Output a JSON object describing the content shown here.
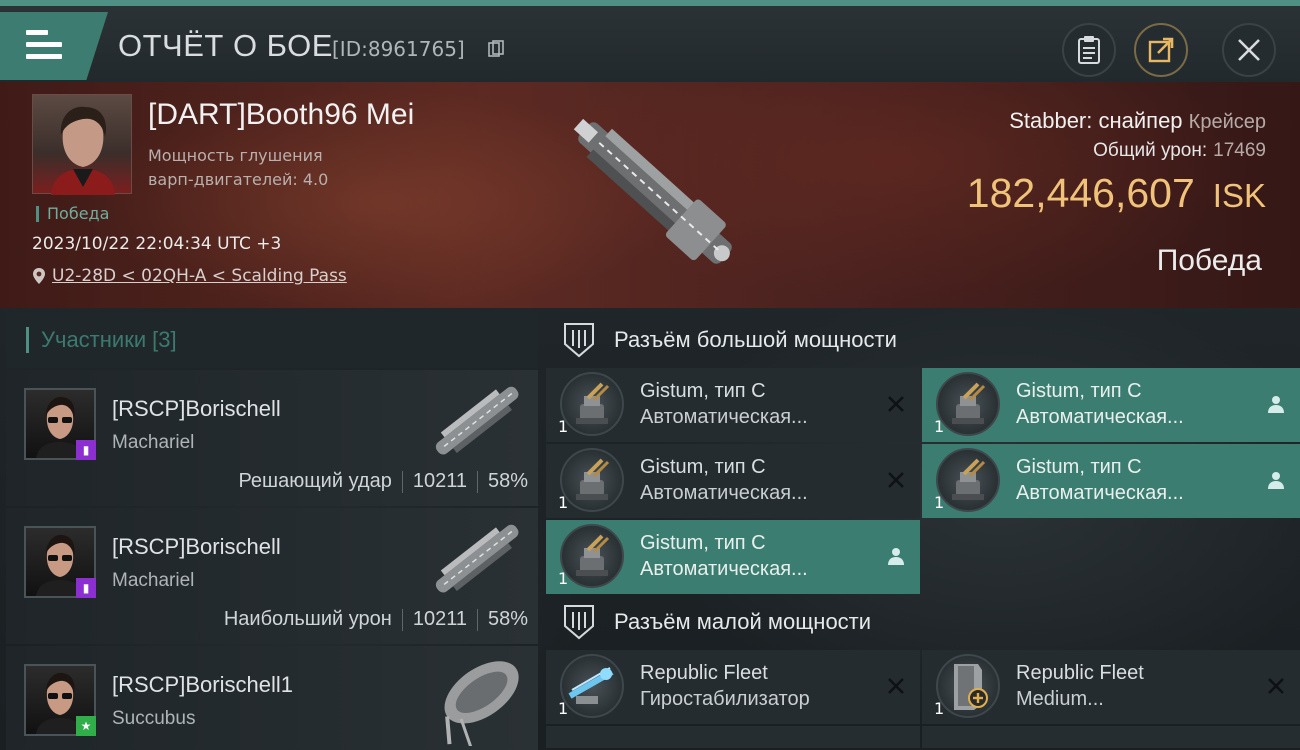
{
  "header": {
    "title": "ОТЧЁТ О БОЕ",
    "report_id": "[ID:8961765]",
    "icons": [
      "menu-icon",
      "copy-icon",
      "clipboard-icon",
      "share-icon",
      "close-icon"
    ]
  },
  "victim": {
    "name": "[DART]Booth96 Mei",
    "stat_line1": "Мощность глушения",
    "stat_line2": "варп-двигателей: 4.0",
    "result": "Победа",
    "datetime": "2023/10/22 22:04:34 UTC +3",
    "location": "U2-28D < 02QH-A < Scalding Pass",
    "ship_name": "Stabber: снайпер",
    "ship_class": "Крейсер",
    "damage_label": "Общий урон:",
    "damage_value": "17469",
    "isk_value": "182,446,607",
    "isk_currency": "ISK",
    "result_right": "Победа"
  },
  "participants": {
    "title": "Участники",
    "count": "[3]",
    "items": [
      {
        "name": "[RSCP]Borischell",
        "ship": "Machariel",
        "role": "Решающий удар",
        "damage": "10211",
        "percent": "58%",
        "badge_color": "#8b2fd1"
      },
      {
        "name": "[RSCP]Borischell",
        "ship": "Machariel",
        "role": "Наибольший урон",
        "damage": "10211",
        "percent": "58%",
        "badge_color": "#8b2fd1"
      },
      {
        "name": "[RSCP]Borischell1",
        "ship": "Succubus",
        "role": "",
        "damage": "",
        "percent": "",
        "badge_color": "#2fae4a"
      }
    ]
  },
  "slots": {
    "high_title": "Разъём большой мощности",
    "low_title": "Разъём малой мощности",
    "high": [
      {
        "qty": "1",
        "line1": "Gistum, тип C",
        "line2": "Автоматическая...",
        "state": "destroyed"
      },
      {
        "qty": "1",
        "line1": "Gistum, тип C",
        "line2": "Автоматическая...",
        "state": "dropped"
      },
      {
        "qty": "1",
        "line1": "Gistum, тип C",
        "line2": "Автоматическая...",
        "state": "destroyed"
      },
      {
        "qty": "1",
        "line1": "Gistum, тип C",
        "line2": "Автоматическая...",
        "state": "dropped"
      },
      {
        "qty": "1",
        "line1": "Gistum, тип C",
        "line2": "Автоматическая...",
        "state": "dropped"
      }
    ],
    "low": [
      {
        "qty": "1",
        "line1": "Republic Fleet",
        "line2": "Гиростабилизатор",
        "state": "destroyed"
      },
      {
        "qty": "1",
        "line1": "Republic Fleet",
        "line2": "Medium...",
        "state": "destroyed"
      }
    ]
  },
  "colors": {
    "accent": "#4e9184",
    "isk": "#f0c27a",
    "fitted_bg": "#3c7d71"
  }
}
